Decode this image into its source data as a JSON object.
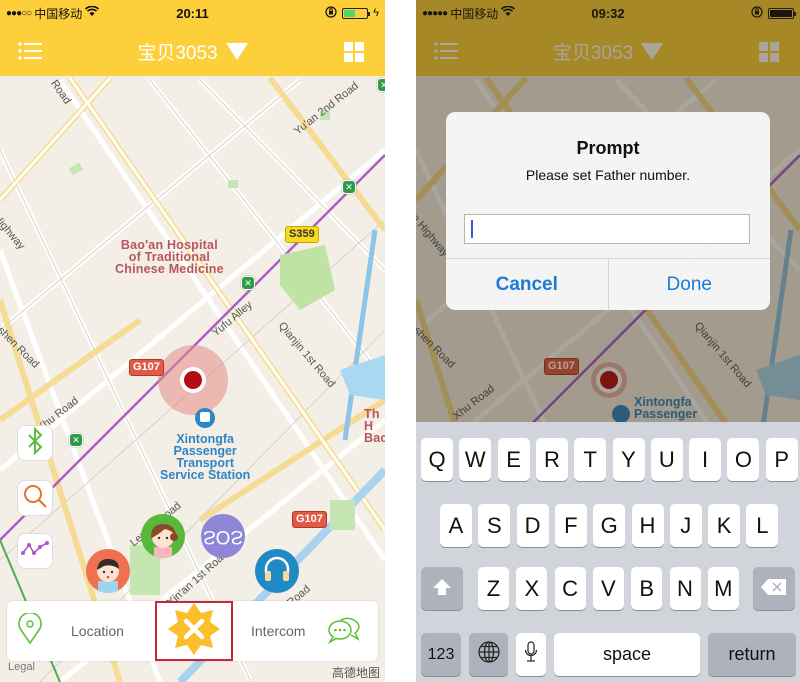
{
  "left_screen": {
    "status_bar": {
      "signal": "●●●○○",
      "carrier": "中国移动",
      "time": "20:11",
      "battery_level": 0.5,
      "battery_color": "#4cd964",
      "charging": true
    },
    "nav": {
      "title": "宝贝3053",
      "menu_icon": "list-icon",
      "grid_icon": "grid-icon",
      "dropdown_icon": "triangle-down-icon",
      "bar_color": "#fccf3b"
    },
    "map": {
      "labels": {
        "road_top": "Road",
        "yuan_2nd": "Yu'an 2nd Road",
        "highway": "Highway",
        "anshen": "Anshen Road",
        "yufu": "Yufu Alley",
        "qianjin": "Qianjin 1st Road",
        "xhu": "Xhu Road",
        "leping": "Leping Road",
        "xinan": "Xin'an 1st Road",
        "road_br": "Road",
        "hospital": "Bao'an Hospital\nof Traditional\nChinese Medicine",
        "station": "Xintongfa\nPassenger\nTransport\nService Station",
        "th_cut": "Th\nH\nBac"
      },
      "shields": {
        "s359": "S359",
        "g107_a": "G107",
        "g107_b": "G107"
      },
      "legal": "Legal",
      "provider": "高德地图"
    },
    "side_buttons": [
      {
        "name": "bluetooth",
        "icon": "bluetooth-icon"
      },
      {
        "name": "search",
        "icon": "search-icon"
      },
      {
        "name": "track",
        "icon": "track-icon"
      }
    ],
    "floating": {
      "sos_label": "SOS",
      "headphones": "headphones-icon",
      "boy": "boy-avatar",
      "girl": "girl-avatar"
    },
    "bottom_bar": {
      "location_label": "Location",
      "intercom_label": "Intercom",
      "center_icon": "close-badge-icon"
    }
  },
  "right_screen": {
    "status_bar": {
      "signal": "●●●●●",
      "carrier": "中国移动",
      "time": "09:32",
      "battery_level": 1.0,
      "battery_color": "#111111",
      "charging": false
    },
    "nav": {
      "title": "宝贝3053"
    },
    "map": {
      "shield": "G107",
      "station": "Xintongfa\nPassenger",
      "labels": {
        "anshen": "Anshen Road",
        "qianjin": "Qianjin 1st Road",
        "xhu": "Xhu Road",
        "highway": "n Highway"
      }
    },
    "alert": {
      "title": "Prompt",
      "message": "Please set Father number.",
      "input_value": "",
      "cancel_label": "Cancel",
      "done_label": "Done"
    },
    "keyboard": {
      "row1": [
        "Q",
        "W",
        "E",
        "R",
        "T",
        "Y",
        "U",
        "I",
        "O",
        "P"
      ],
      "row2": [
        "A",
        "S",
        "D",
        "F",
        "G",
        "H",
        "J",
        "K",
        "L"
      ],
      "row3": [
        "Z",
        "X",
        "C",
        "V",
        "B",
        "N",
        "M"
      ],
      "shift_icon": "shift-icon",
      "delete_icon": "backspace-icon",
      "numbers_label": "123",
      "globe_icon": "globe-icon",
      "mic_icon": "microphone-icon",
      "space_label": "space",
      "return_label": "return"
    }
  }
}
